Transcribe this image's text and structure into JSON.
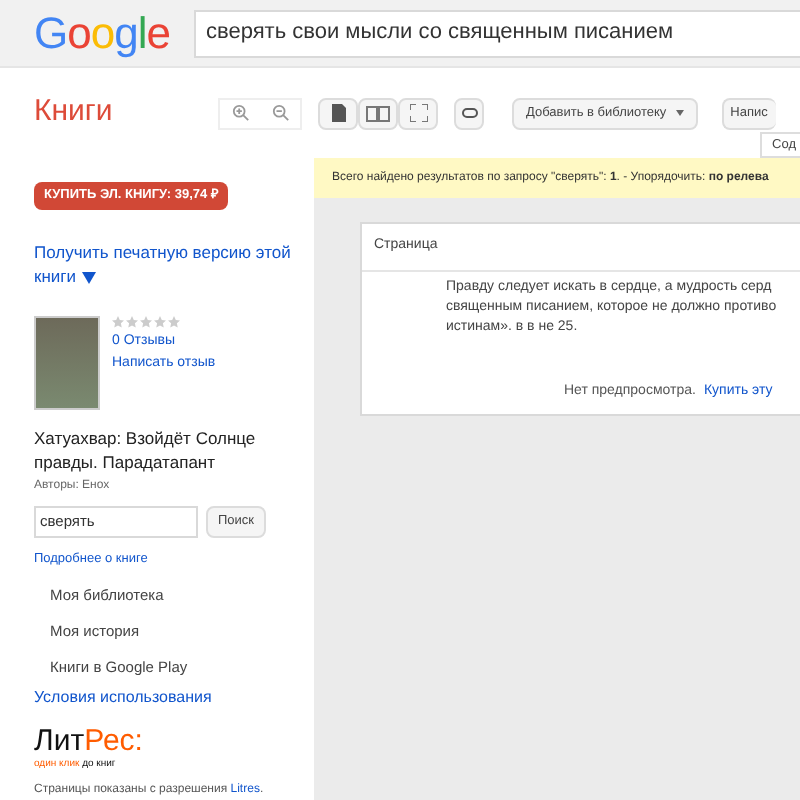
{
  "header": {
    "logo": "Google",
    "search_query": "сверять свои мысли со священным писанием"
  },
  "toolbar": {
    "title": "Книги",
    "add_to_library": "Добавить в библиотеку",
    "write_button": "Напис",
    "contents_tab": "Сод"
  },
  "notice": "Всего найдено результатов по запросу \"сверять\": **1**. -  Упорядочить: **по релева**",
  "sidebar": {
    "buy_button": "КУПИТЬ ЭЛ. КНИГУ: 39,74 ₽",
    "print_link": "Получить печатную версию этой книги",
    "book": {
      "stars": 0,
      "reviews": "0 Отзывы",
      "write_review": "Написать отзыв",
      "title": "Хатуахвар: Взойдёт Солнце правды. Парадатапант",
      "authors": "Авторы: Енох"
    },
    "search": {
      "value": "сверять",
      "button": "Поиск"
    },
    "more_link": "Подробнее о книге",
    "nav": [
      "Моя библиотека",
      "Моя история",
      "Книги в Google Play"
    ],
    "terms": "Условия использования",
    "publisher": {
      "logo_left": "Лит",
      "logo_right": "Рес:",
      "tagline_left": "один клик",
      "tagline_right": "до книг"
    },
    "permission": {
      "text": "Страницы показаны с разрешения",
      "link": "Litres",
      "end": "."
    }
  },
  "results": {
    "header": "Страница",
    "snippet": [
      "Правду следует искать в сердце, а мудрость серд",
      "священным писанием, которое не должно противо",
      "истинам». в в не 25."
    ],
    "no_preview": "Нет предпросмотра.",
    "buy_link": "Купить эту"
  }
}
